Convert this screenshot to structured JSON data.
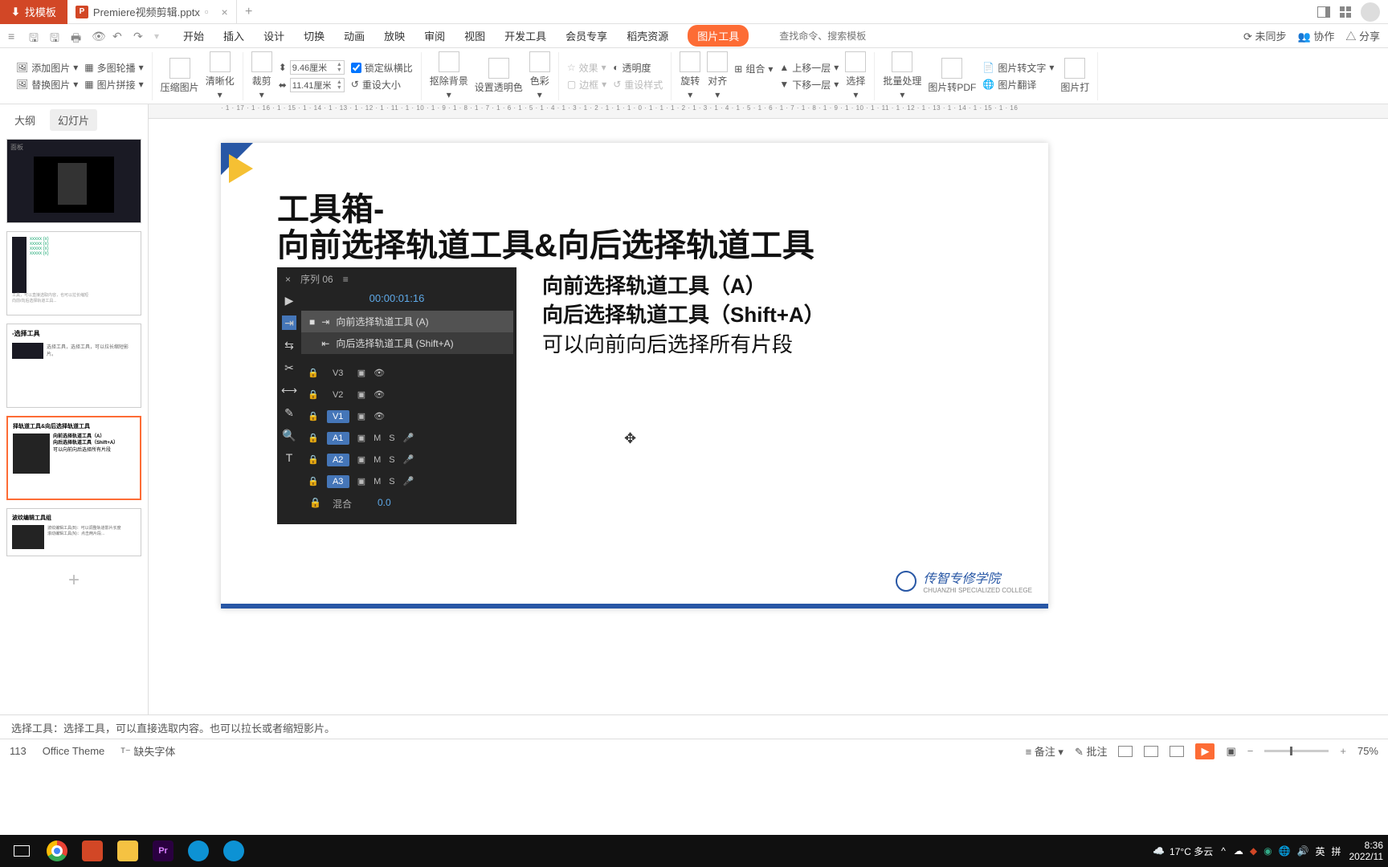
{
  "titlebar": {
    "template_tab": "找模板",
    "file_tab": "Premiere视频剪辑.pptx",
    "close": "×",
    "new_tab": "+"
  },
  "ribbon_tabs": [
    "开始",
    "插入",
    "设计",
    "切换",
    "动画",
    "放映",
    "审阅",
    "视图",
    "开发工具",
    "会员专享",
    "稻壳资源"
  ],
  "ribbon_active": "图片工具",
  "search_placeholder": "查找命令、搜索模板",
  "sync_label": "未同步",
  "coop_label": "协作",
  "share_label": "分享",
  "ribbon": {
    "add_image": "添加图片",
    "multi_carousel": "多图轮播",
    "replace_image": "替换图片",
    "image_stitch": "图片拼接",
    "compress": "压缩图片",
    "clarity": "清晰化",
    "crop": "裁剪",
    "width": "9.46厘米",
    "height": "11.41厘米",
    "lock_ratio": "锁定纵横比",
    "reset_size": "重设大小",
    "remove_bg": "抠除背景",
    "set_transparent": "设置透明色",
    "color": "色彩",
    "effects": "效果",
    "border": "边框",
    "reset_style": "重设样式",
    "transparency": "透明度",
    "rotate": "旋转",
    "align": "对齐",
    "group": "组合",
    "bring_forward": "上移一层",
    "send_backward": "下移一层",
    "select": "选择",
    "batch": "批量处理",
    "to_pdf": "图片转PDF",
    "to_text": "图片转文字",
    "translate": "图片翻译",
    "print": "图片打"
  },
  "side_tabs": {
    "outline": "大纲",
    "slides": "幻灯片"
  },
  "slide": {
    "title1": "工具箱-",
    "title2": "向前选择轨道工具&向后选择轨道工具",
    "seq": "序列 06",
    "tc": "00:00:01:16",
    "sub1": "向前选择轨道工具 (A)",
    "sub2": "向后选择轨道工具 (Shift+A)",
    "right1": "向前选择轨道工具（A）",
    "right2": "向后选择轨道工具（Shift+A）",
    "right3": "可以向前向后选择所有片段",
    "tracks_v": [
      "V3",
      "V2",
      "V1"
    ],
    "tracks_a": [
      "A1",
      "A2",
      "A3"
    ],
    "mix": "混合",
    "mix_val": "0.0",
    "logo_text": "传智专修学院",
    "logo_sub": "CHUANZHI SPECIALIZED COLLEGE"
  },
  "thumb4_title": "择轨道工具&向后选择轨道工具",
  "thumb4_line1": "向前选择轨道工具（A）",
  "thumb4_line2": "向后选择轨道工具（Shift+A）",
  "thumb4_line3": "可以向前向后选择所有片段",
  "thumb5_title": "波纹编辑工具组",
  "notes": "选择工具：选择工具，可以直接选取内容。也可以拉长或者缩短影片。",
  "status": {
    "slide_num": "113",
    "theme": "Office Theme",
    "missing_fonts": "缺失字体",
    "notes_btn": "备注",
    "comments_btn": "批注",
    "zoom": "75%"
  },
  "taskbar": {
    "weather": "17°C 多云",
    "ime1": "英",
    "ime2": "拼",
    "time": "8:36",
    "date": "2022/11"
  }
}
